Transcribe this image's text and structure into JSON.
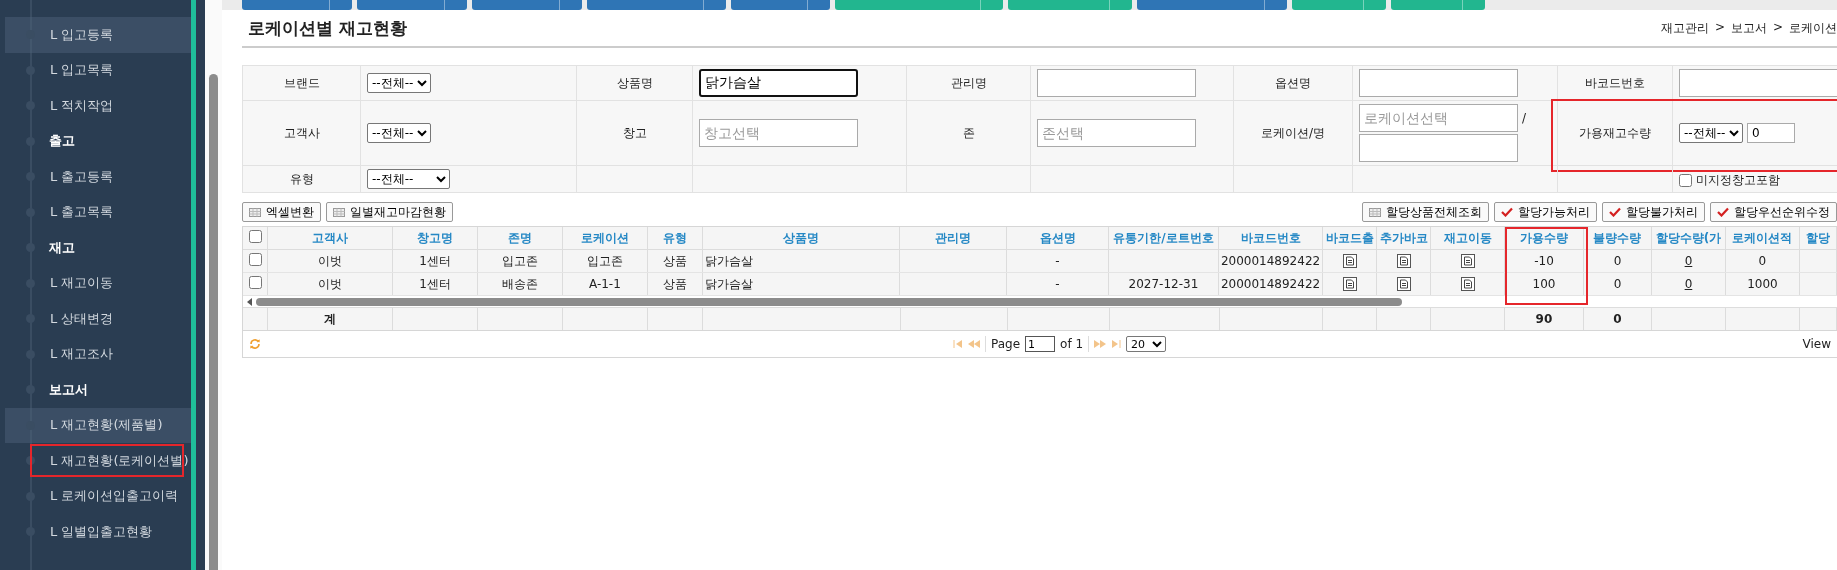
{
  "toolbar_buttons": [
    {
      "color": "#2f75b5"
    },
    {
      "color": "#2f75b5"
    },
    {
      "color": "#2f75b5"
    },
    {
      "color": "#2f75b5"
    },
    {
      "color": "#2f75b5"
    },
    {
      "color": "#22b68f"
    },
    {
      "color": "#22b68f"
    },
    {
      "color": "#2f75b5"
    },
    {
      "color": "#22b68f"
    },
    {
      "color": "#22b68f"
    }
  ],
  "sidebar": {
    "items": [
      {
        "kind": "link",
        "label": "L 입고등록",
        "selected": true,
        "highlighted": false
      },
      {
        "kind": "link",
        "label": "L 입고목록",
        "selected": false,
        "highlighted": false
      },
      {
        "kind": "link",
        "label": "L 적치작업",
        "selected": false,
        "highlighted": false
      },
      {
        "kind": "header",
        "label": "출고",
        "selected": false,
        "highlighted": false
      },
      {
        "kind": "link",
        "label": "L 출고등록",
        "selected": false,
        "highlighted": false
      },
      {
        "kind": "link",
        "label": "L 출고목록",
        "selected": false,
        "highlighted": false
      },
      {
        "kind": "header",
        "label": "재고",
        "selected": false,
        "highlighted": false
      },
      {
        "kind": "link",
        "label": "L 재고이동",
        "selected": false,
        "highlighted": false
      },
      {
        "kind": "link",
        "label": "L 상태변경",
        "selected": false,
        "highlighted": false
      },
      {
        "kind": "link",
        "label": "L 재고조사",
        "selected": false,
        "highlighted": false
      },
      {
        "kind": "header",
        "label": "보고서",
        "selected": false,
        "highlighted": false
      },
      {
        "kind": "link",
        "label": "L 재고현황(제품별)",
        "selected": true,
        "highlighted": false
      },
      {
        "kind": "link",
        "label": "L 재고현황(로케이션별)",
        "selected": false,
        "highlighted": true
      },
      {
        "kind": "link",
        "label": "L 로케이션입출고이력",
        "selected": false,
        "highlighted": false
      },
      {
        "kind": "link",
        "label": "L 일별입출고현황",
        "selected": false,
        "highlighted": false
      }
    ]
  },
  "page_title": "로케이션별 재고현황",
  "breadcrumb": [
    "재고관리",
    ">",
    "보고서",
    ">",
    "로케이션"
  ],
  "filters": [
    [
      {
        "label": "브랜드",
        "highlighted": false,
        "controls": [
          {
            "kind": "select",
            "value": "--전체--"
          }
        ]
      },
      {
        "label": "상품명",
        "highlighted": false,
        "controls": [
          {
            "kind": "input",
            "value": "닭가슴살",
            "focused": true
          }
        ]
      },
      {
        "label": "관리명",
        "highlighted": false,
        "controls": [
          {
            "kind": "input",
            "focused": false
          }
        ]
      },
      {
        "label": "옵션명",
        "highlighted": false,
        "controls": [
          {
            "kind": "input",
            "focused": false
          }
        ]
      },
      {
        "label": "바코드번호",
        "highlighted": false,
        "controls": [
          {
            "kind": "input",
            "focused": false
          }
        ]
      }
    ],
    [
      {
        "label": "고객사",
        "highlighted": false,
        "controls": [
          {
            "kind": "select",
            "value": "--전체--"
          }
        ]
      },
      {
        "label": "창고",
        "highlighted": false,
        "controls": [
          {
            "kind": "input",
            "placeholder": "창고선택",
            "focused": false
          }
        ]
      },
      {
        "label": "존",
        "highlighted": false,
        "controls": [
          {
            "kind": "input",
            "placeholder": "존선택",
            "focused": false
          }
        ]
      },
      {
        "label": "로케이션/명",
        "highlighted": false,
        "controls": [
          {
            "kind": "input",
            "placeholder": "로케이션선택",
            "focused": false
          },
          {
            "kind": "text",
            "text": "/"
          },
          {
            "kind": "input",
            "focused": false
          }
        ]
      },
      {
        "label": "가용재고수량",
        "highlighted": true,
        "controls": [
          {
            "kind": "select",
            "value": "--전체--"
          },
          {
            "kind": "small-input",
            "value": "0",
            "focused": false
          }
        ]
      }
    ],
    [
      {
        "label": "유형",
        "highlighted": false,
        "controls": [
          {
            "kind": "select",
            "value": "--전체--"
          }
        ]
      },
      {
        "controls": [
          {
            "kind": "checkbox",
            "label": "미지정창고포함",
            "checked": false
          }
        ]
      }
    ]
  ],
  "left_buttons": [
    {
      "label": "엑셀변환",
      "kind": "plain"
    },
    {
      "label": "일별재고마감현황",
      "kind": "plain"
    }
  ],
  "right_buttons": [
    {
      "label": "할당상품전체조회",
      "kind": "plain"
    },
    {
      "label": "할당가능처리",
      "kind": "action"
    },
    {
      "label": "할당불가처리",
      "kind": "action"
    },
    {
      "label": "할당우선순위수정",
      "kind": "action"
    }
  ],
  "table": {
    "all_checked": false,
    "columns": [
      {
        "label": "고객사",
        "highlighted": false,
        "total": "계"
      },
      {
        "label": "창고명",
        "highlighted": false
      },
      {
        "label": "존명",
        "highlighted": false
      },
      {
        "label": "로케이션",
        "highlighted": false
      },
      {
        "label": "유형",
        "highlighted": false
      },
      {
        "label": "상품명",
        "highlighted": false
      },
      {
        "label": "관리명",
        "highlighted": false
      },
      {
        "label": "옵션명",
        "highlighted": false
      },
      {
        "label": "유통기한/로트번호",
        "highlighted": false
      },
      {
        "label": "바코드번호",
        "highlighted": false
      },
      {
        "label": "바코드출",
        "highlighted": false
      },
      {
        "label": "추가바코",
        "highlighted": false
      },
      {
        "label": "재고이동",
        "highlighted": false
      },
      {
        "label": "가용수량",
        "highlighted": true,
        "total": "90"
      },
      {
        "label": "불량수량",
        "highlighted": false,
        "total": "0"
      },
      {
        "label": "할당수량(가",
        "highlighted": false
      },
      {
        "label": "로케이션적",
        "highlighted": false
      },
      {
        "label": "할당",
        "highlighted": false
      }
    ],
    "rows": [
      {
        "checked": false,
        "cells": [
          {
            "kind": "text",
            "text": "이벗"
          },
          {
            "kind": "text",
            "text": "1센터"
          },
          {
            "kind": "text",
            "text": "입고존"
          },
          {
            "kind": "text",
            "text": "입고존"
          },
          {
            "kind": "text",
            "text": "상품"
          },
          {
            "kind": "name",
            "text": "닭가슴살"
          },
          {
            "kind": "empty"
          },
          {
            "kind": "text",
            "text": "-"
          },
          {
            "kind": "empty"
          },
          {
            "kind": "text",
            "text": "2000014892422"
          },
          {
            "kind": "icon"
          },
          {
            "kind": "icon"
          },
          {
            "kind": "icon"
          },
          {
            "kind": "text",
            "text": "-10"
          },
          {
            "kind": "text",
            "text": "0"
          },
          {
            "kind": "link",
            "text": "0"
          },
          {
            "kind": "text",
            "text": "0"
          },
          {
            "kind": "empty"
          }
        ]
      },
      {
        "checked": false,
        "cells": [
          {
            "kind": "text",
            "text": "이벗"
          },
          {
            "kind": "text",
            "text": "1센터"
          },
          {
            "kind": "text",
            "text": "배송존"
          },
          {
            "kind": "text",
            "text": "A-1-1"
          },
          {
            "kind": "text",
            "text": "상품"
          },
          {
            "kind": "name",
            "text": "닭가슴살"
          },
          {
            "kind": "empty"
          },
          {
            "kind": "text",
            "text": "-"
          },
          {
            "kind": "text",
            "text": "2027-12-31"
          },
          {
            "kind": "text",
            "text": "2000014892422"
          },
          {
            "kind": "icon"
          },
          {
            "kind": "icon"
          },
          {
            "kind": "icon"
          },
          {
            "kind": "text",
            "text": "100"
          },
          {
            "kind": "text",
            "text": "0"
          },
          {
            "kind": "link",
            "text": "0"
          },
          {
            "kind": "text",
            "text": "1000"
          },
          {
            "kind": "empty"
          }
        ]
      }
    ]
  },
  "pager": {
    "page_label": "Page",
    "page": "1",
    "of_label": "of 1",
    "page_size": "20",
    "view_label": "View"
  }
}
